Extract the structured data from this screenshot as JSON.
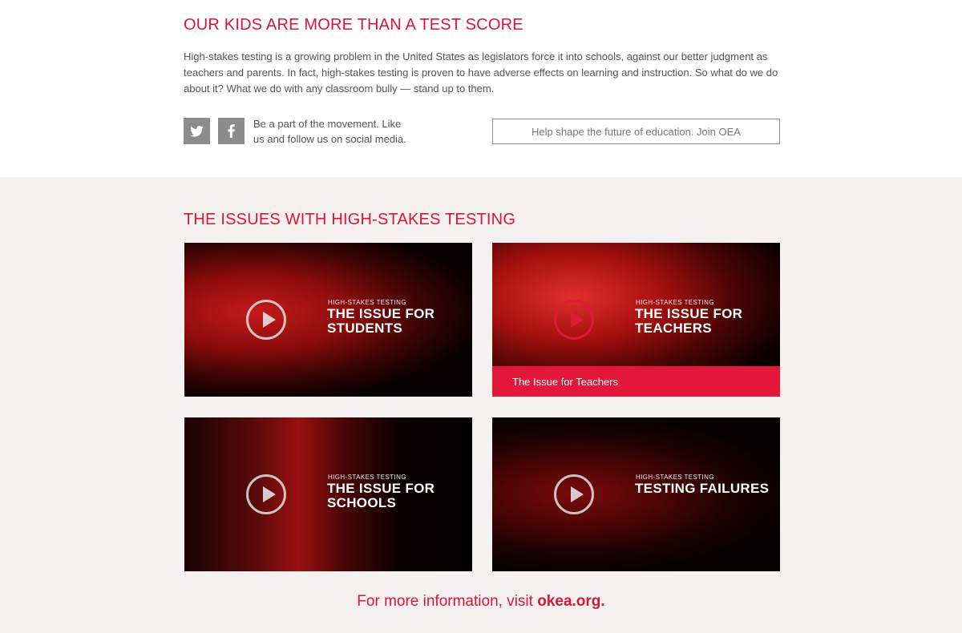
{
  "section1": {
    "heading": "OUR KIDS ARE MORE THAN A TEST SCORE",
    "intro": "High-stakes testing is a growing problem in the United States as legislators force it into schools, against our better judgment as teachers and parents. In fact, high-stakes testing is proven to have adverse effects on learning and instruction. So what do we do about it? What we do with any classroom bully — stand up to them.",
    "social": {
      "icons": [
        "twitter-icon",
        "facebook-icon"
      ],
      "text": "Be a part of the movement. Like us and follow us on social media."
    },
    "join_button": "Help shape the future of education. Join OEA"
  },
  "section2": {
    "heading": "THE ISSUES WITH HIGH-STAKES TESTING",
    "cards": [
      {
        "kicker": "HIGH-STAKES TESTING",
        "title": "THE ISSUE FOR STUDENTS"
      },
      {
        "kicker": "HIGH-STAKES TESTING",
        "title": "THE ISSUE FOR TEACHERS",
        "caption": "The Issue for Teachers"
      },
      {
        "kicker": "HIGH-STAKES TESTING",
        "title": "THE ISSUE FOR SCHOOLS"
      },
      {
        "kicker": "HIGH-STAKES TESTING",
        "title": "TESTING FAILURES"
      }
    ]
  },
  "footer": {
    "prefix": "For more information, visit ",
    "link": "okea.org."
  },
  "colors": {
    "accent": "#d9163a",
    "caption_bg": "#e3173a",
    "section_bg": "#f4f1f0",
    "icon_bg": "#8c8c8c"
  }
}
